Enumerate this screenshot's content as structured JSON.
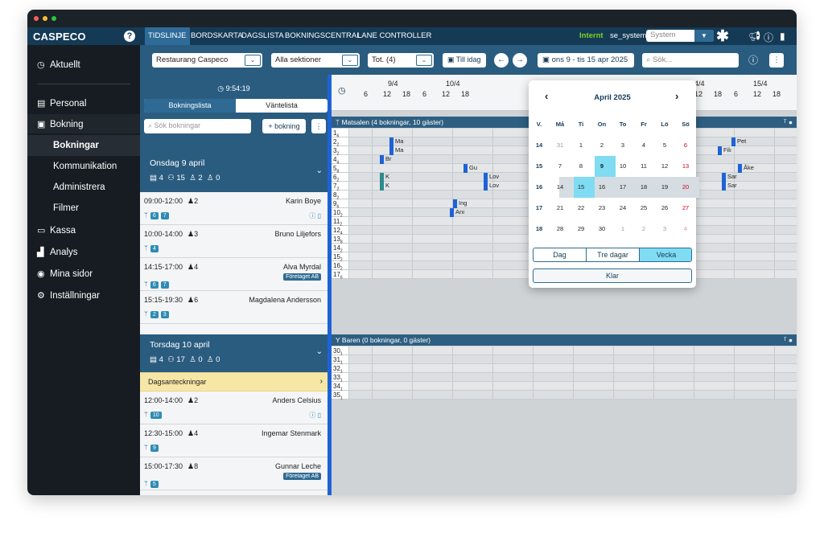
{
  "titlebar": {
    "dots": [
      "#ff5f57",
      "#febc2e",
      "#28c840"
    ]
  },
  "topnav": {
    "logo": "CASPECO",
    "help": "?",
    "tabs": [
      "TIDSLINJE",
      "BORDSKARTA",
      "DAGSLISTA",
      "BOKNINGSCENTRAL",
      "LANE CONTROLLER"
    ],
    "active_tab": "TIDSLINJE",
    "env_label": "Internt",
    "user": "se_system",
    "system_select": "System",
    "icons": [
      "asterisk-icon",
      "megaphone-icon",
      "info-icon",
      "document-icon"
    ]
  },
  "sidebar": {
    "items": [
      {
        "label": "Aktuellt",
        "icon": "clock-icon"
      },
      {
        "label": "Personal",
        "icon": "id-card-icon"
      },
      {
        "label": "Bokning",
        "icon": "calendar-icon"
      }
    ],
    "subitems": [
      "Bokningar",
      "Kommunikation",
      "Administrera",
      "Filmer"
    ],
    "active_subitem": "Bokningar",
    "bottom_items": [
      {
        "label": "Kassa",
        "icon": "cash-register-icon"
      },
      {
        "label": "Analys",
        "icon": "chart-icon"
      },
      {
        "label": "Mina sidor",
        "icon": "user-icon"
      },
      {
        "label": "Inställningar",
        "icon": "gear-icon"
      }
    ]
  },
  "filters": {
    "restaurant": "Restaurang Caspeco",
    "section": "Alla sektioner",
    "total": "Tot. (4)",
    "today_btn": "Till idag",
    "date_range": "ons 9 - tis 15 apr 2025",
    "search_placeholder": "Sök..."
  },
  "booking_panel": {
    "clock": "9:54:19",
    "tab_list": "Bokningslista",
    "tab_wait": "Väntelista",
    "search_placeholder": "Sök bokningar",
    "add_button": "+ bokning",
    "days": [
      {
        "title": "Onsdag 9 april",
        "stats": [
          "4",
          "15",
          "2",
          "0"
        ]
      },
      {
        "title": "Torsdag 10 april",
        "stats": [
          "4",
          "17",
          "0",
          "0"
        ]
      }
    ],
    "bookings_day1": [
      {
        "time": "09:00-12:00",
        "guests": "2",
        "name": "Karin Boye",
        "company": "",
        "tables": [
          "6",
          "7"
        ]
      },
      {
        "time": "10:00-14:00",
        "guests": "3",
        "name": "Bruno Liljefors",
        "company": "",
        "tables": [
          "4"
        ]
      },
      {
        "time": "14:15-17:00",
        "guests": "4",
        "name": "Alva Myrdal",
        "company": "Företaget AB",
        "tables": [
          "6",
          "7"
        ]
      },
      {
        "time": "15:15-19:30",
        "guests": "6",
        "name": "Magdalena Andersson",
        "company": "",
        "tables": [
          "2",
          "3"
        ]
      }
    ],
    "notes_label": "Dagsanteckningar",
    "bookings_day2": [
      {
        "time": "12:00-14:00",
        "guests": "2",
        "name": "Anders Celsius",
        "company": "",
        "tables": [
          "10"
        ]
      },
      {
        "time": "12:30-15:00",
        "guests": "4",
        "name": "Ingemar Stenmark",
        "company": "",
        "tables": [
          "9"
        ]
      },
      {
        "time": "15:00-17:30",
        "guests": "8",
        "name": "Gunnar Leche",
        "company": "Företaget AB",
        "tables": [
          "5"
        ]
      }
    ]
  },
  "timeline": {
    "days": [
      "9/4",
      "10/4",
      "14/4",
      "15/4"
    ],
    "hours": [
      "6",
      "12",
      "18"
    ],
    "section1": "Matsalen (4 bokningar, 10 gäster)",
    "section2": "Baren (0 bokningar, 0 gäster)",
    "tables1": [
      {
        "n": "1",
        "s": "6"
      },
      {
        "n": "2",
        "s": "2"
      },
      {
        "n": "3",
        "s": "2"
      },
      {
        "n": "4",
        "s": "4"
      },
      {
        "n": "5",
        "s": "8"
      },
      {
        "n": "6",
        "s": "2"
      },
      {
        "n": "7",
        "s": "2"
      },
      {
        "n": "8",
        "s": "2"
      },
      {
        "n": "9",
        "s": "6"
      },
      {
        "n": "10",
        "s": "2"
      },
      {
        "n": "11",
        "s": "2"
      },
      {
        "n": "12",
        "s": "4"
      },
      {
        "n": "13",
        "s": "8"
      },
      {
        "n": "14",
        "s": "2"
      },
      {
        "n": "15",
        "s": "2"
      },
      {
        "n": "16",
        "s": "2"
      },
      {
        "n": "17",
        "s": "6"
      }
    ],
    "tables2": [
      {
        "n": "30",
        "s": "1"
      },
      {
        "n": "31",
        "s": "1"
      },
      {
        "n": "32",
        "s": "1"
      },
      {
        "n": "33",
        "s": "1"
      },
      {
        "n": "34",
        "s": "1"
      },
      {
        "n": "35",
        "s": "1"
      }
    ],
    "bookings": [
      {
        "label": "Ma",
        "row": 1,
        "day": 0,
        "hour": 12,
        "color": "blue"
      },
      {
        "label": "Ma",
        "row": 2,
        "day": 0,
        "hour": 12,
        "color": "blue"
      },
      {
        "label": "Br",
        "row": 3,
        "day": 0,
        "hour": 9,
        "color": "blue"
      },
      {
        "label": "Gu",
        "row": 4,
        "day": 1,
        "hour": 10,
        "color": "blue"
      },
      {
        "label": "K",
        "row": 5,
        "day": 0,
        "hour": 9,
        "color": "teal"
      },
      {
        "label": "K",
        "row": 6,
        "day": 0,
        "hour": 9,
        "color": "teal"
      },
      {
        "label": "Lov",
        "row": 5,
        "day": 1,
        "hour": 16,
        "color": "blue"
      },
      {
        "label": "Lov",
        "row": 6,
        "day": 1,
        "hour": 16,
        "color": "blue"
      },
      {
        "label": "Ing",
        "row": 8,
        "day": 1,
        "hour": 7,
        "color": "blue"
      },
      {
        "label": "Anı",
        "row": 9,
        "day": 1,
        "hour": 6,
        "color": "blue"
      },
      {
        "label": "Pet",
        "row": 1,
        "day": 2,
        "hour": 18,
        "color": "blue"
      },
      {
        "label": "Filı",
        "row": 2,
        "day": 2,
        "hour": 14,
        "color": "blue"
      },
      {
        "label": "Åke",
        "row": 4,
        "day": 2,
        "hour": 20,
        "color": "blue"
      },
      {
        "label": "Sar",
        "row": 5,
        "day": 2,
        "hour": 15,
        "color": "blue"
      },
      {
        "label": "Sar",
        "row": 6,
        "day": 2,
        "hour": 15,
        "color": "blue"
      }
    ]
  },
  "calendar": {
    "month": "April 2025",
    "headers": [
      "V.",
      "Må",
      "Ti",
      "On",
      "To",
      "Fr",
      "Lö",
      "Sö"
    ],
    "weeks": [
      {
        "wk": "14",
        "days": [
          "31",
          "1",
          "2",
          "3",
          "4",
          "5",
          "6"
        ]
      },
      {
        "wk": "15",
        "days": [
          "7",
          "8",
          "9",
          "10",
          "11",
          "12",
          "13"
        ]
      },
      {
        "wk": "16",
        "days": [
          "14",
          "15",
          "16",
          "17",
          "18",
          "19",
          "20"
        ]
      },
      {
        "wk": "17",
        "days": [
          "21",
          "22",
          "23",
          "24",
          "25",
          "26",
          "27"
        ]
      },
      {
        "wk": "18",
        "days": [
          "28",
          "29",
          "30",
          "1",
          "2",
          "3",
          "4"
        ]
      }
    ],
    "view_buttons": [
      "Dag",
      "Tre dagar",
      "Vecka"
    ],
    "active_view": "Vecka",
    "done_button": "Klar"
  }
}
